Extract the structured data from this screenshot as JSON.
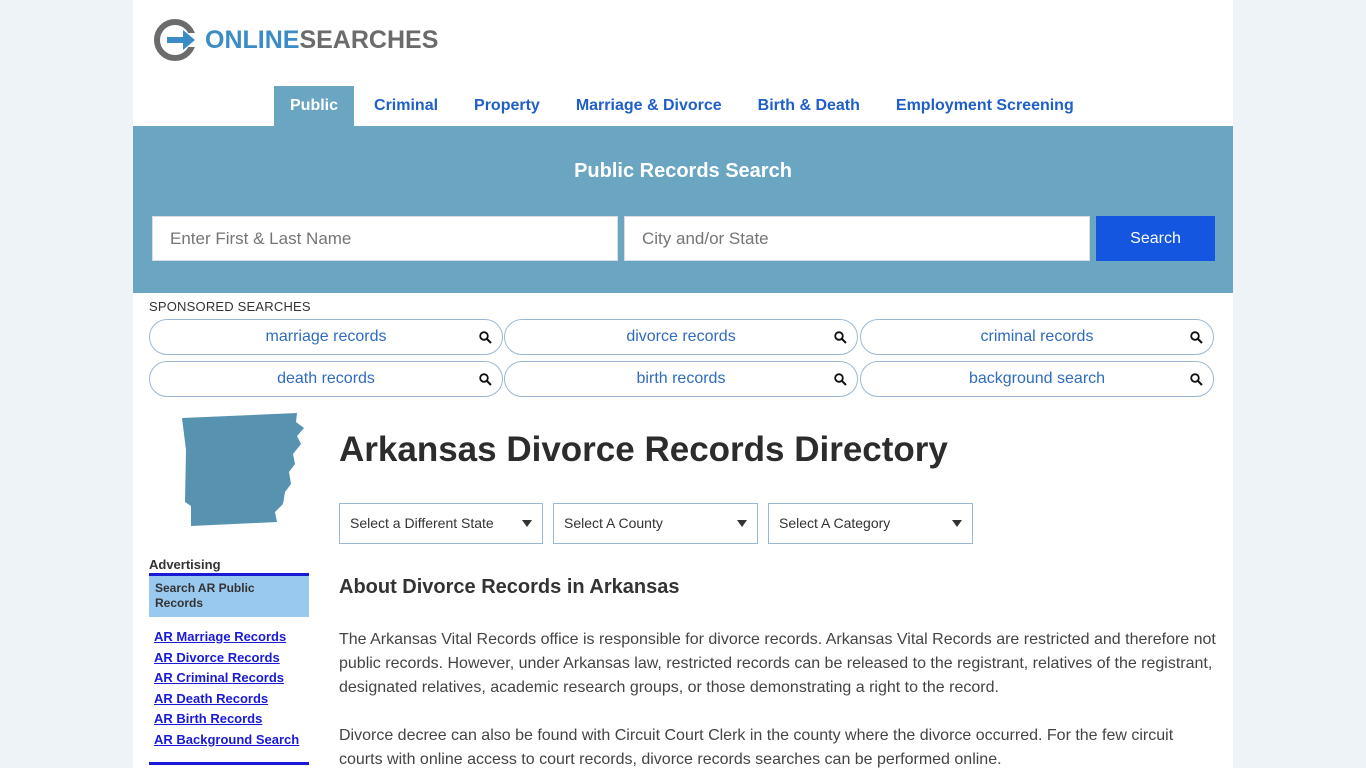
{
  "logo": {
    "part1": "ONLINE",
    "part2": "SEARCHES"
  },
  "nav": [
    {
      "label": "Public",
      "active": true
    },
    {
      "label": "Criminal"
    },
    {
      "label": "Property"
    },
    {
      "label": "Marriage & Divorce"
    },
    {
      "label": "Birth & Death"
    },
    {
      "label": "Employment Screening"
    }
  ],
  "search": {
    "title": "Public Records Search",
    "name_placeholder": "Enter First & Last Name",
    "city_placeholder": "City and/or State",
    "button": "Search"
  },
  "sponsored": {
    "label": "SPONSORED SEARCHES",
    "items": [
      "marriage records",
      "divorce records",
      "criminal records",
      "death records",
      "birth records",
      "background search"
    ]
  },
  "sidebar": {
    "advertising": "Advertising",
    "box_title": "Search AR Public Records",
    "links": [
      "AR Marriage Records",
      "AR Divorce Records",
      "AR Criminal Records",
      "AR Death Records",
      "AR Birth Records",
      "AR Background Search"
    ]
  },
  "main": {
    "title": "Arkansas Divorce Records Directory",
    "selects": [
      "Select a Different State",
      "Select A County",
      "Select A Category"
    ],
    "subtitle": "About Divorce Records in Arkansas",
    "para1": "The Arkansas Vital Records office is responsible for divorce records. Arkansas Vital Records are restricted and therefore not public records. However, under Arkansas law, restricted records can be released to the registrant, relatives of the registrant, designated relatives, academic research groups, or those demonstrating a right to the record.",
    "para2": "Divorce decree can also be found with Circuit Court Clerk in the county where the divorce occurred. For the few circuit courts with online access to court records, divorce records searches can be performed online."
  },
  "colors": {
    "band": "#6aa6c2",
    "button": "#1556e0",
    "link": "#1a1ad6",
    "nav": "#1f5fc7",
    "map": "#5793b0"
  },
  "icons": [
    "logo-icon",
    "search-icon",
    "arkansas-map-icon",
    "caret-down-icon"
  ]
}
